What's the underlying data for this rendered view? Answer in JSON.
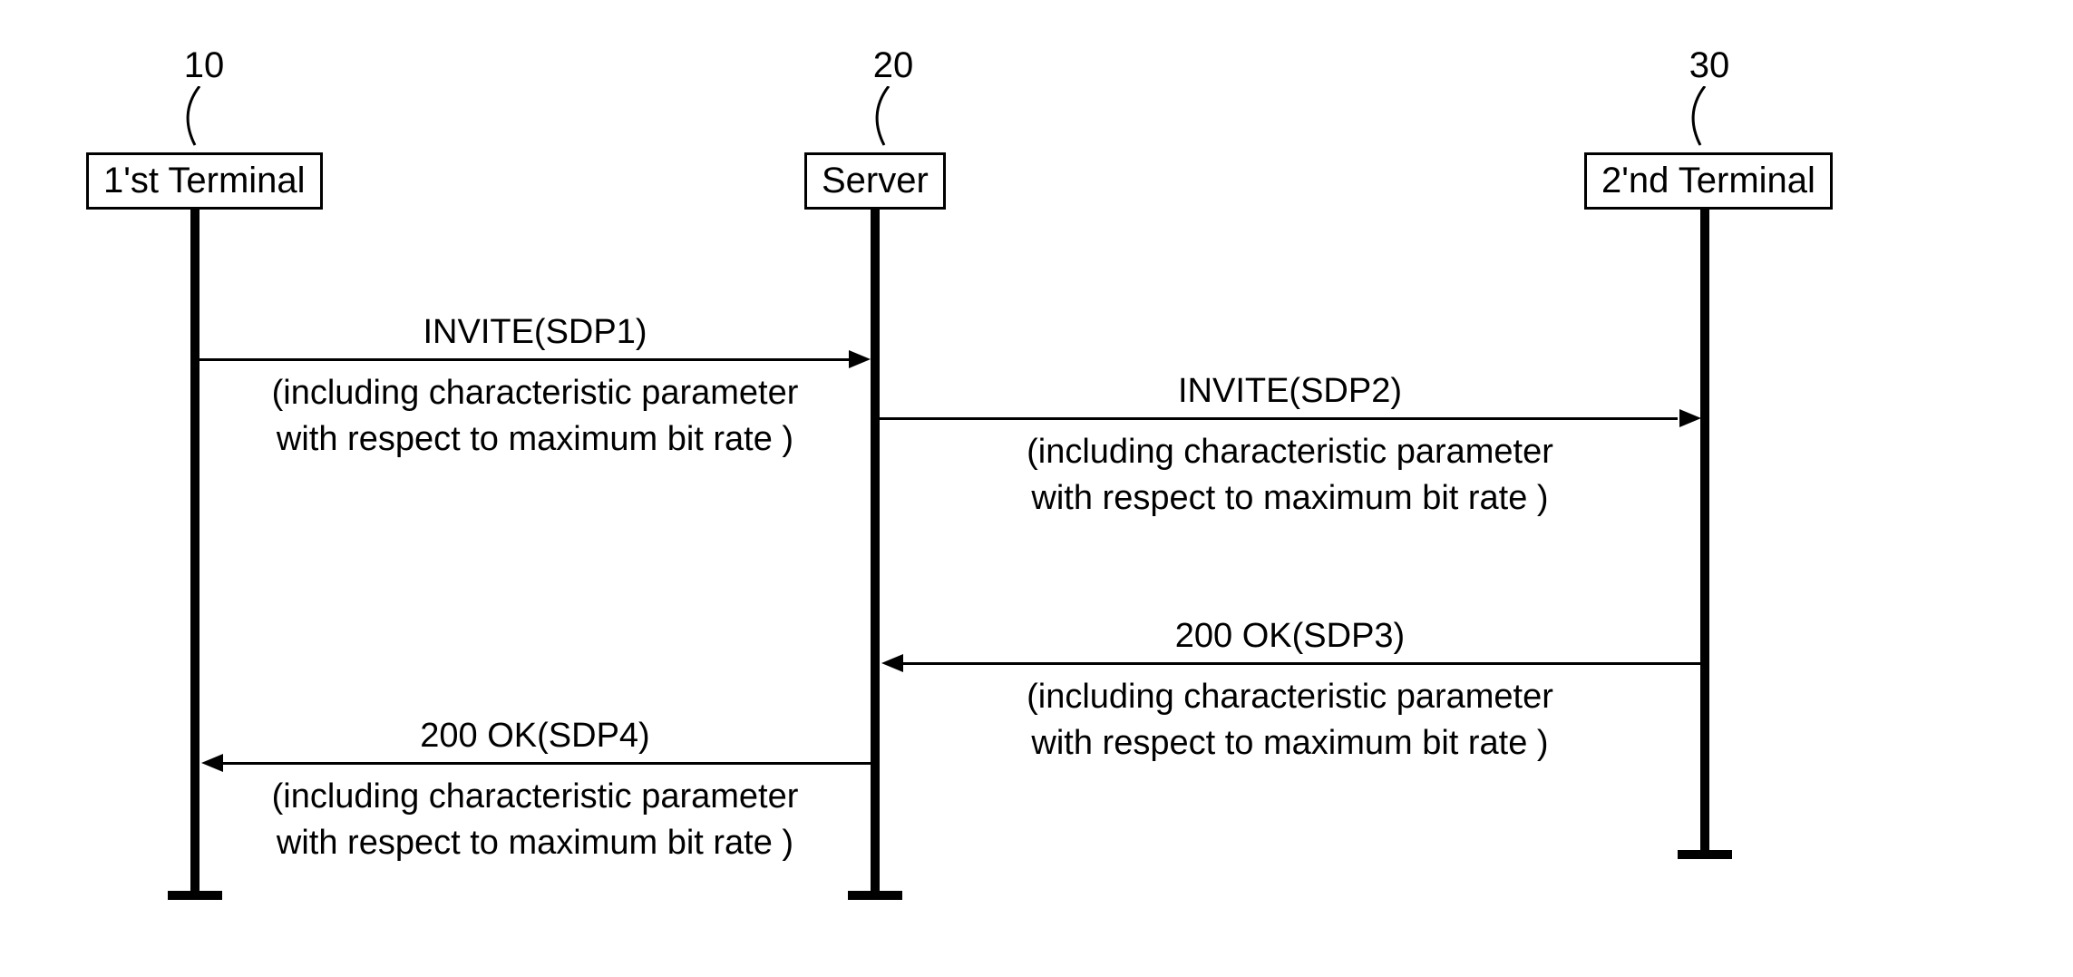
{
  "refs": {
    "t1": "10",
    "server": "20",
    "t2": "30"
  },
  "nodes": {
    "t1": "1'st Terminal",
    "server": "Server",
    "t2": "2'nd Terminal"
  },
  "messages": {
    "invite1": {
      "label": "INVITE(SDP1)",
      "sub1": "(including characteristic parameter",
      "sub2": "with respect to maximum bit rate )"
    },
    "invite2": {
      "label": "INVITE(SDP2)",
      "sub1": "(including characteristic parameter",
      "sub2": "with respect to maximum bit rate )"
    },
    "ok3": {
      "label": "200 OK(SDP3)",
      "sub1": "(including characteristic parameter",
      "sub2": "with respect to maximum bit rate )"
    },
    "ok4": {
      "label": "200 OK(SDP4)",
      "sub1": "(including characteristic parameter",
      "sub2": "with respect to maximum bit rate )"
    }
  }
}
